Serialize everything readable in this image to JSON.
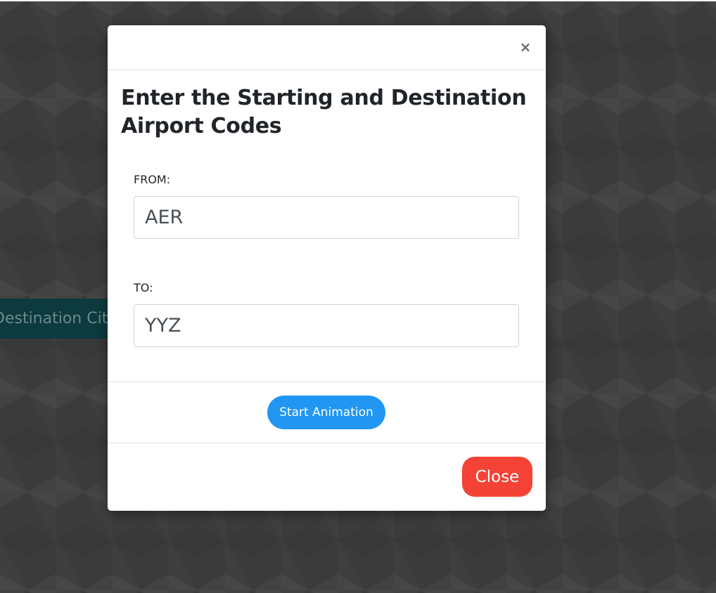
{
  "background": {
    "pill_text": "Destination City"
  },
  "modal": {
    "close_icon": "×",
    "title": "Enter the Starting and Destination Airport Codes",
    "from": {
      "label": "FROM:",
      "value": "AER"
    },
    "to": {
      "label": "TO:",
      "value": "YYZ"
    },
    "start_button": "Start Animation",
    "close_button": "Close"
  },
  "colors": {
    "accent_blue": "#2196f3",
    "close_red": "#f44336",
    "background_dark": "#3b3b3b"
  }
}
